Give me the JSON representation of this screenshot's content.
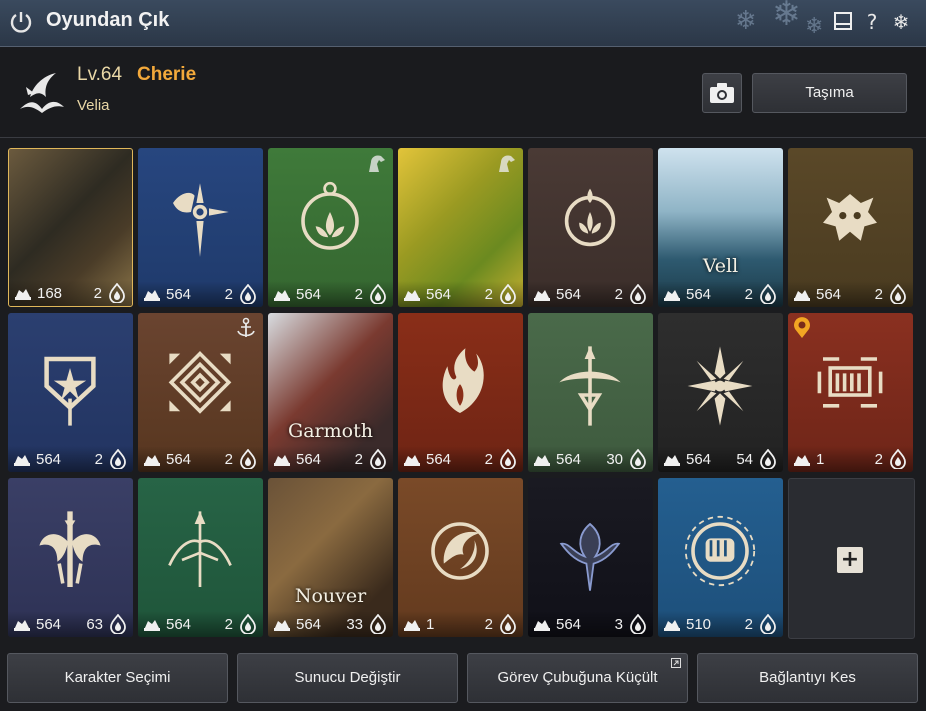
{
  "window": {
    "title": "Oyundan Çık"
  },
  "character": {
    "level": "Lv.64",
    "name": "Cherie",
    "server": "Velia"
  },
  "header": {
    "move_label": "Taşıma"
  },
  "slots": [
    {
      "theme": "portrait",
      "energy": "168",
      "count": "2",
      "selected": true
    },
    {
      "theme": "blue",
      "energy": "564",
      "count": "2"
    },
    {
      "theme": "green",
      "energy": "564",
      "count": "2"
    },
    {
      "theme": "field",
      "energy": "564",
      "count": "2"
    },
    {
      "theme": "brown",
      "energy": "564",
      "count": "2"
    },
    {
      "theme": "vell",
      "energy": "564",
      "count": "2",
      "label": "Vell"
    },
    {
      "theme": "olive",
      "energy": "564",
      "count": "2"
    },
    {
      "theme": "navy",
      "energy": "564",
      "count": "2"
    },
    {
      "theme": "rust",
      "energy": "564",
      "count": "2"
    },
    {
      "theme": "garmoth",
      "energy": "564",
      "count": "2",
      "label": "Garmoth"
    },
    {
      "theme": "red",
      "energy": "564",
      "count": "2"
    },
    {
      "theme": "sage",
      "energy": "564",
      "count": "30"
    },
    {
      "theme": "dark",
      "energy": "564",
      "count": "54"
    },
    {
      "theme": "crimson",
      "energy": "1",
      "count": "2"
    },
    {
      "theme": "slate",
      "energy": "564",
      "count": "63"
    },
    {
      "theme": "teal",
      "energy": "564",
      "count": "2"
    },
    {
      "theme": "nouver",
      "energy": "564",
      "count": "33",
      "label": "Nouver"
    },
    {
      "theme": "copper",
      "energy": "1",
      "count": "2"
    },
    {
      "theme": "black",
      "energy": "564",
      "count": "3"
    },
    {
      "theme": "ocean",
      "energy": "510",
      "count": "2"
    }
  ],
  "footer": {
    "char_select": "Karakter Seçimi",
    "change_server": "Sunucu Değiştir",
    "minimize": "Görev Çubuğuna Küçült",
    "disconnect": "Bağlantıyı Kes"
  },
  "colors": {
    "accent": "#f3a93b",
    "selected_border": "#e0b75a"
  }
}
